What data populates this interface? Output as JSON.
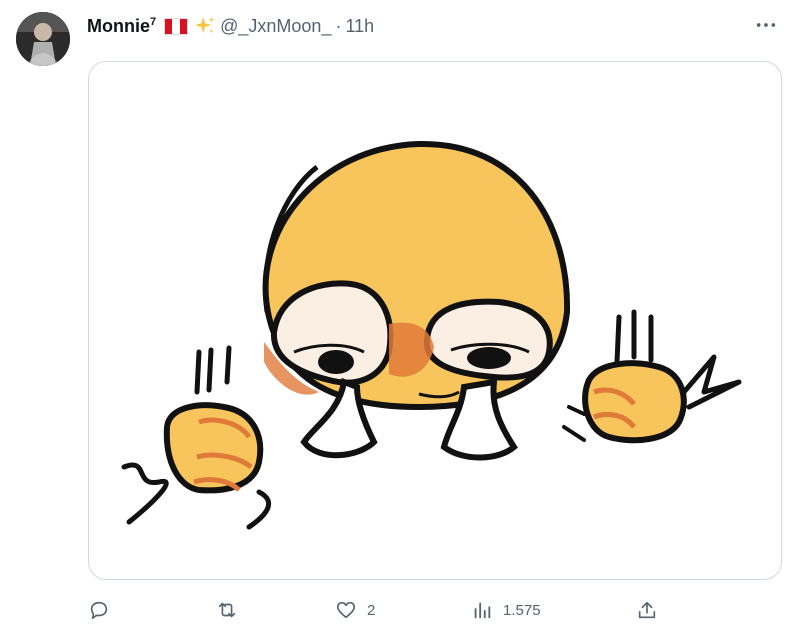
{
  "author": {
    "name": "Monnie",
    "superscript": "7",
    "handle": "@_JxnMoon_",
    "separator": "·",
    "time": "11h",
    "flag_colors": [
      "#d91023",
      "#ffffff",
      "#d91023"
    ],
    "sparkle_color": "#f4c542"
  },
  "icons": {
    "more": "more-options-icon",
    "reply": "reply-icon",
    "retweet": "retweet-icon",
    "like": "heart-icon",
    "views": "views-icon",
    "share": "share-icon"
  },
  "actions": {
    "reply_count": "",
    "retweet_count": "",
    "like_count": "2",
    "views_count": "1.575"
  },
  "colors": {
    "text_secondary": "#536471",
    "emoji_yellow": "#f7c55b",
    "emoji_orange": "#e07a3a"
  }
}
